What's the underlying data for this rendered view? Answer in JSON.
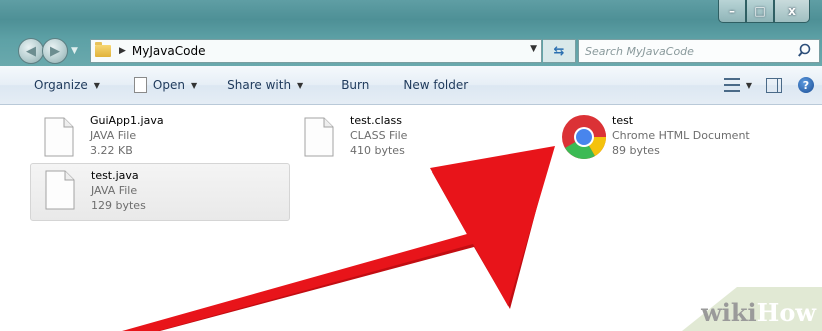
{
  "window": {
    "title_controls": [
      "–",
      "□",
      "x"
    ]
  },
  "address_bar": {
    "breadcrumb": "MyJavaCode"
  },
  "search": {
    "placeholder": "Search MyJavaCode"
  },
  "toolbar": {
    "organize": "Organize",
    "open": "Open",
    "share_with": "Share with",
    "burn": "Burn",
    "new_folder": "New folder",
    "help": "?"
  },
  "files": [
    {
      "name": "GuiApp1.java",
      "type": "JAVA File",
      "size": "3.22 KB",
      "icon": "page-icon"
    },
    {
      "name": "test.class",
      "type": "CLASS File",
      "size": "410 bytes",
      "icon": "page-icon"
    },
    {
      "name": "test",
      "type": "Chrome HTML Document",
      "size": "89 bytes",
      "icon": "chrome-icon"
    },
    {
      "name": "test.java",
      "type": "JAVA File",
      "size": "129 bytes",
      "icon": "page-icon",
      "selected": true
    }
  ],
  "colors": {
    "arrow": "#e8141a",
    "frame": "#5a9ba0",
    "toolbar_text": "#1e395b"
  },
  "watermark": {
    "wiki": "wiki",
    "how": "How"
  }
}
